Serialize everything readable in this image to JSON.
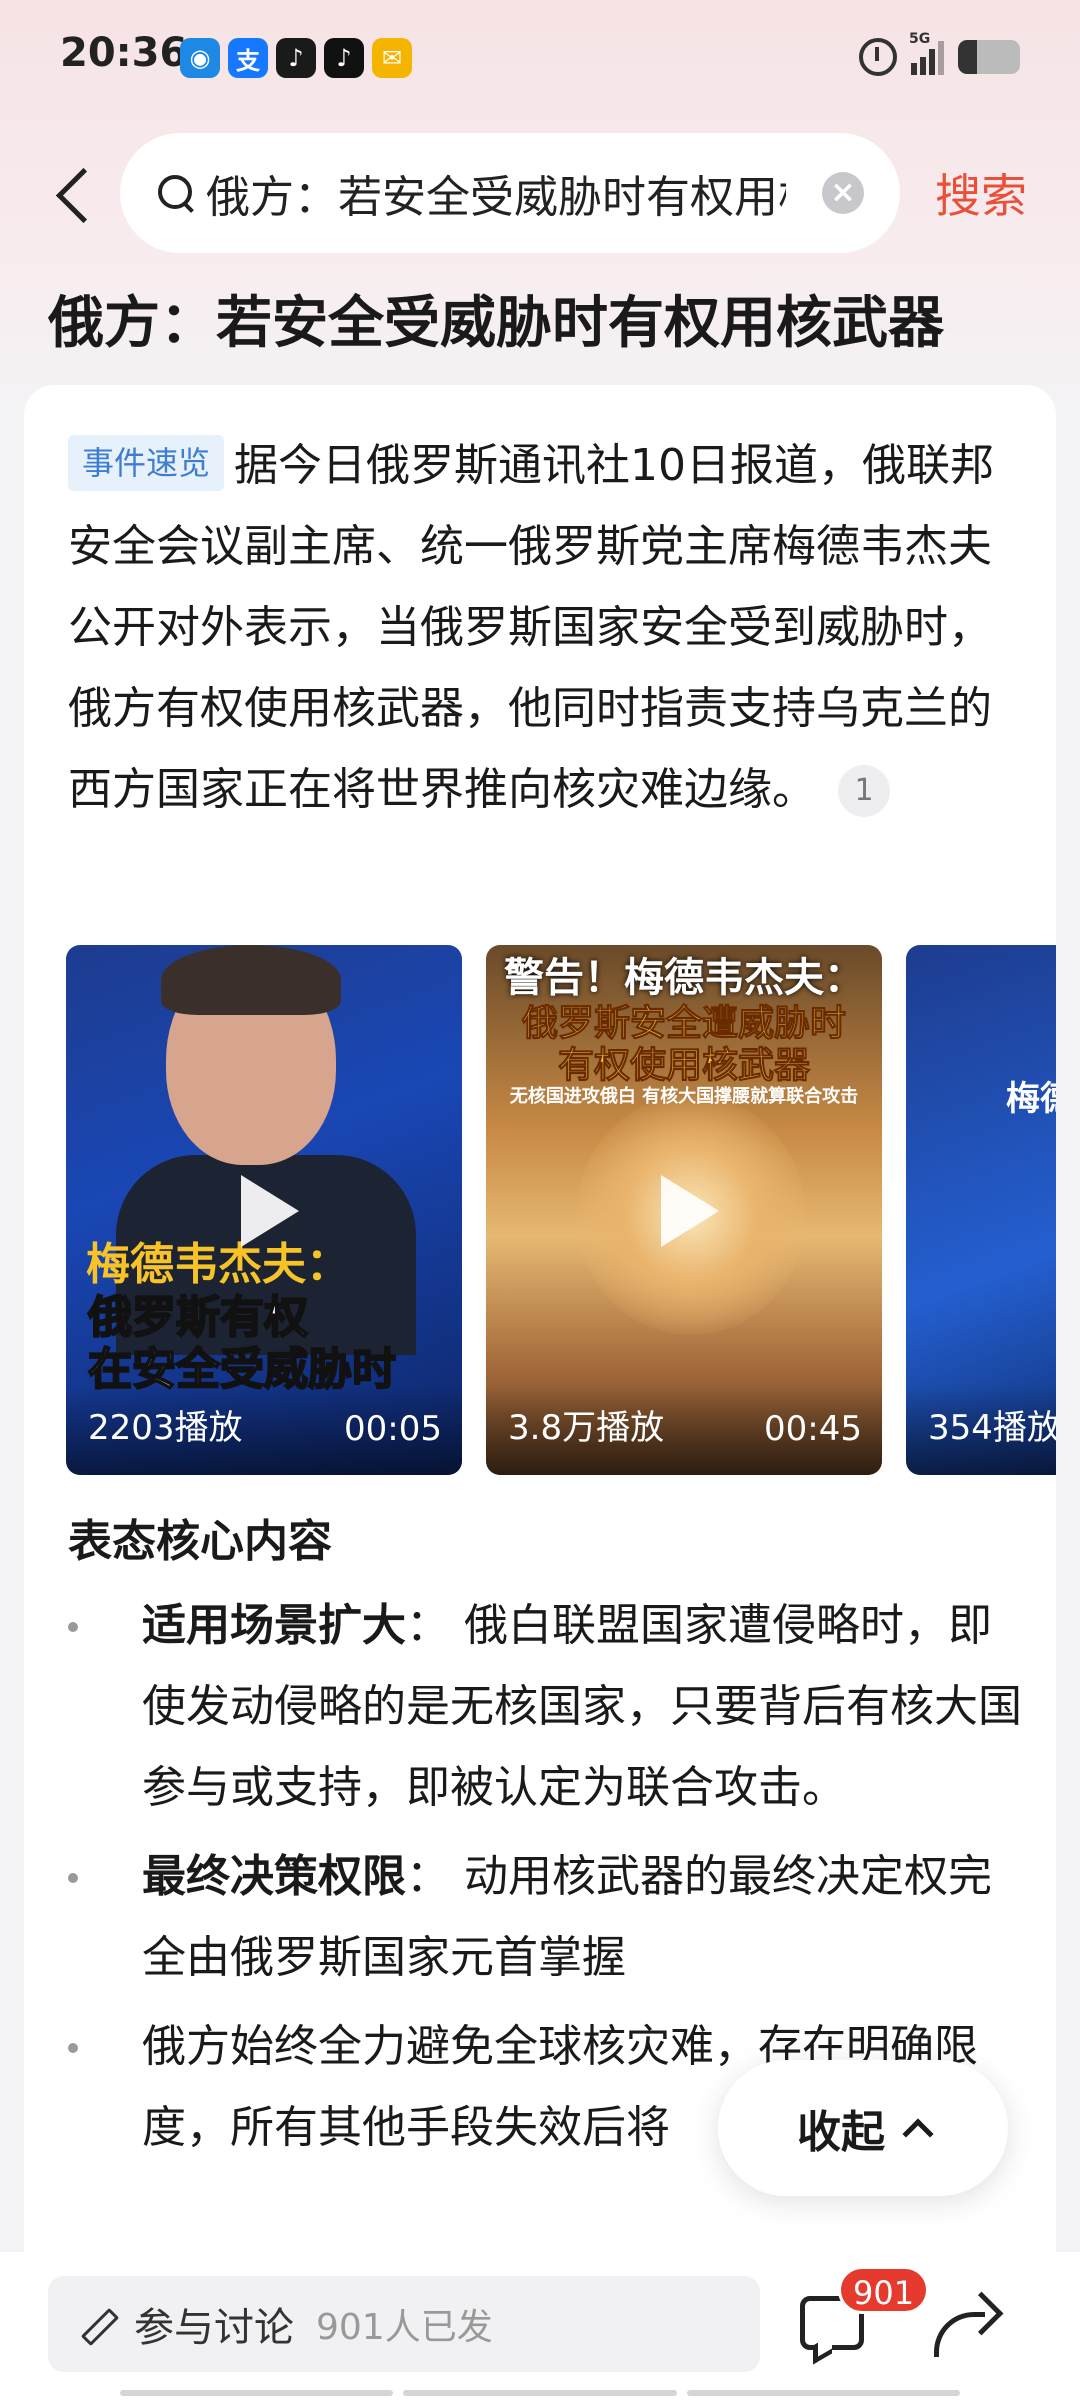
{
  "status_bar": {
    "time": "20:36",
    "network": "5G",
    "battery_level": 0.3,
    "app_icons": [
      {
        "name": "bilibili-like-icon",
        "glyph": "◉",
        "color": "#1e88e5"
      },
      {
        "name": "alipay-icon",
        "glyph": "支",
        "color": "#1677ff"
      },
      {
        "name": "music-app-icon",
        "glyph": "♪",
        "color": "#1a1a1a"
      },
      {
        "name": "tiktok-icon",
        "glyph": "♪",
        "color": "#111111"
      },
      {
        "name": "mail-icon",
        "glyph": "✉",
        "color": "#f5b400"
      }
    ]
  },
  "search": {
    "query": "俄方：若安全受威胁时有权用核武器",
    "action_label": "搜索"
  },
  "page_title": "俄方：若安全受威胁时有权用核武器",
  "summary": {
    "tag": "事件速览",
    "text": "据今日俄罗斯通讯社10日报道，俄联邦安全会议副主席、统一俄罗斯党主席梅德韦杰夫公开对外表示，当俄罗斯国家安全受到威胁时，俄方有权使用核武器，他同时指责支持乌克兰的西方国家正在将世界推向核灾难边缘。",
    "citation": "1"
  },
  "videos": [
    {
      "overlay_lines": [
        "梅德韦杰夫：",
        "俄罗斯有权",
        "在安全受威胁时"
      ],
      "views": "2203播放",
      "duration": "00:05"
    },
    {
      "overlay_lines": [
        "警告！梅德韦杰夫：",
        "俄罗斯安全遭威胁时",
        "有权使用核武器",
        "无核国进攻俄白 有核大国撑腰就算联合攻击"
      ],
      "views": "3.8万播放",
      "duration": "00:45"
    },
    {
      "overlay_lines": [
        "梅德"
      ],
      "views": "354播放",
      "duration": ""
    }
  ],
  "section": {
    "heading": "表态核心内容",
    "bullets": [
      {
        "bold": "适用场景扩大",
        "text": "：  俄白联盟国家遭侵略时，即使发动侵略的是无核国家，只要背后有核大国参与或支持，即被认定为联合攻击。"
      },
      {
        "bold": "最终决策权限",
        "text": "：  动用核武器的最终决定权完全由俄罗斯国家元首掌握"
      },
      {
        "bold": "",
        "text": "俄方始终全力避免全球核灾难，存在明确限度，所有其他手段失效后将"
      }
    ]
  },
  "collapse_label": "收起",
  "bottom_bar": {
    "discuss_label": "参与讨论",
    "discuss_count": "901人已发",
    "comment_badge": "901"
  }
}
